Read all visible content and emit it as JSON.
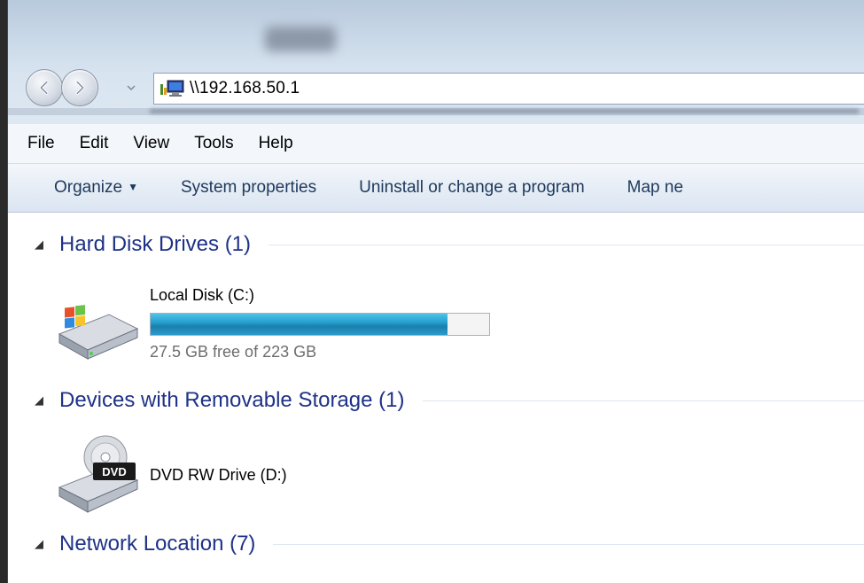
{
  "window": {
    "address": "\\\\192.168.50.1"
  },
  "menu": [
    "File",
    "Edit",
    "View",
    "Tools",
    "Help"
  ],
  "commands": {
    "organize": "Organize",
    "system_properties": "System properties",
    "uninstall": "Uninstall or change a program",
    "map_network": "Map ne"
  },
  "groups": [
    {
      "title": "Hard Disk Drives (1)"
    },
    {
      "title": "Devices with Removable Storage (1)"
    },
    {
      "title": "Network Location (7)"
    }
  ],
  "drives": {
    "local_disk": {
      "label": "Local Disk (C:)",
      "free_text": "27.5 GB free of 223 GB",
      "used_fraction": 0.877,
      "icon": "hard-drive-windows-icon"
    },
    "dvd": {
      "label": "DVD RW Drive (D:)",
      "icon": "dvd-drive-icon",
      "badge": "DVD"
    }
  },
  "colors": {
    "group_title": "#1e3287",
    "command_text": "#1e395b",
    "usage_fill": "#26a0d0"
  }
}
